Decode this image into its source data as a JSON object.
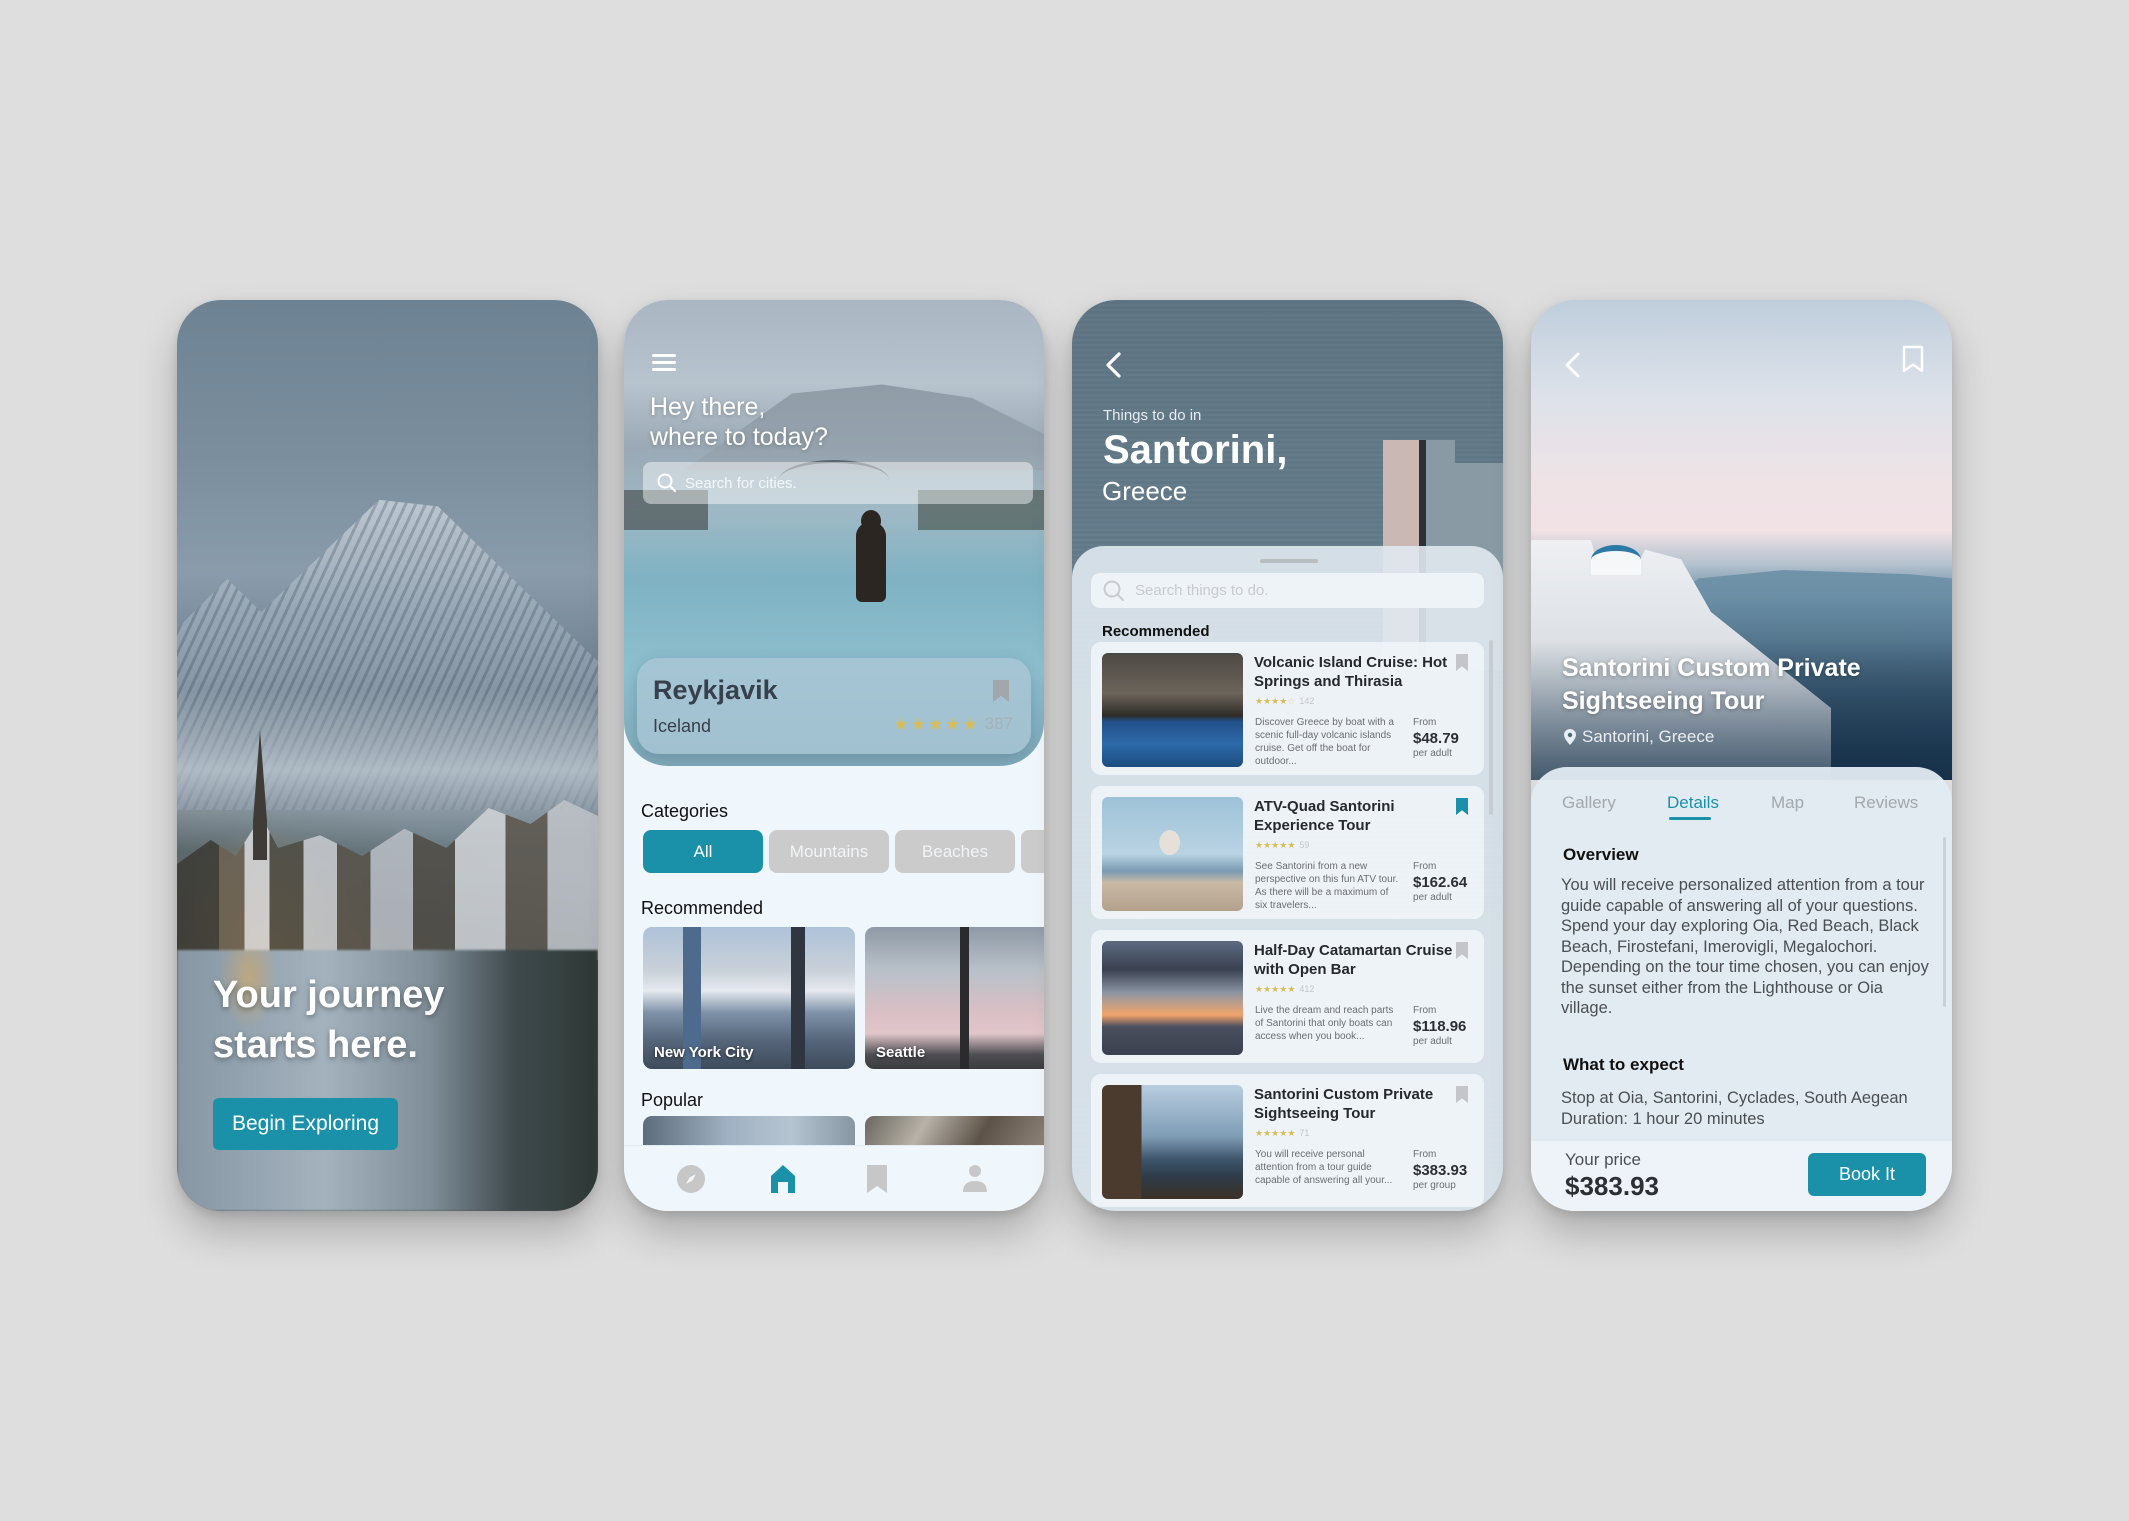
{
  "colors": {
    "accent": "#1a91a9",
    "background": "#dedede",
    "star": "#d6bd57"
  },
  "welcome": {
    "title_line1": "Your journey",
    "title_line2": "starts here.",
    "cta_label": "Begin Exploring"
  },
  "home": {
    "menu_icon": "hamburger-menu-icon",
    "greeting_line1": "Hey there,",
    "greeting_line2": "where to today?",
    "search_placeholder": "Search for cities.",
    "featured": {
      "city": "Reykjavik",
      "country": "Iceland",
      "rating": 5,
      "review_count": "387",
      "bookmarked": false
    },
    "categories_heading": "Categories",
    "categories": [
      {
        "label": "All",
        "active": true
      },
      {
        "label": "Mountains",
        "active": false
      },
      {
        "label": "Beaches",
        "active": false
      },
      {
        "label": "",
        "active": false
      }
    ],
    "recommended_heading": "Recommended",
    "recommended": [
      {
        "label": "New York City"
      },
      {
        "label": "Seattle"
      }
    ],
    "popular_heading": "Popular",
    "nav": [
      {
        "icon": "compass-icon",
        "label": "Explore",
        "active": false
      },
      {
        "icon": "home-icon",
        "label": "Home",
        "active": true
      },
      {
        "icon": "bookmark-icon",
        "label": "Saved",
        "active": false
      },
      {
        "icon": "profile-icon",
        "label": "Profile",
        "active": false
      }
    ]
  },
  "things_to_do": {
    "subtitle": "Things to do in",
    "city": "Santorini,",
    "country": "Greece",
    "search_placeholder": "Search things to do.",
    "recommended_heading": "Recommended",
    "activities": [
      {
        "title": "Volcanic Island Cruise: Hot Springs and Thirasia",
        "rating": 4,
        "review_count": "142",
        "description": "Discover Greece by boat with a scenic full-day volcanic islands cruise. Get off the boat for outdoor...",
        "from_label": "From",
        "price": "$48.79",
        "unit": "per adult",
        "bookmarked": false
      },
      {
        "title": "ATV-Quad Santorini Experience Tour",
        "rating": 5,
        "review_count": "59",
        "description": "See Santorini from a new perspective on this fun ATV tour. As there will be a maximum of six travelers...",
        "from_label": "From",
        "price": "$162.64",
        "unit": "per adult",
        "bookmarked": true
      },
      {
        "title": "Half-Day Catamartan Cruise with Open Bar",
        "rating": 5,
        "review_count": "412",
        "description": "Live the dream and reach parts of Santorini that only boats can access when you book...",
        "from_label": "From",
        "price": "$118.96",
        "unit": "per adult",
        "bookmarked": false
      },
      {
        "title": "Santorini Custom Private Sightseeing Tour",
        "rating": 5,
        "review_count": "71",
        "description": "You will receive personal attention from a tour guide capable of answering all your...",
        "from_label": "From",
        "price": "$383.93",
        "unit": "per group",
        "bookmarked": false
      }
    ]
  },
  "details": {
    "title": "Santorini Custom Private Sightseeing Tour",
    "location": "Santorini, Greece",
    "tabs": [
      {
        "label": "Gallery",
        "active": false
      },
      {
        "label": "Details",
        "active": true
      },
      {
        "label": "Map",
        "active": false
      },
      {
        "label": "Reviews",
        "active": false
      }
    ],
    "overview_heading": "Overview",
    "overview_text": "You will receive personalized attention from a tour guide capable of answering all of your questions. Spend your day exploring Oia, Red Beach, Black Beach, Firostefani, Imerovigli, Megalochori. Depending on the tour time chosen, you can enjoy the sunset either from the Lighthouse or Oia village.",
    "expect_heading": "What to expect",
    "expect_line1": "Stop at Oia, Santorini, Cyclades, South Aegean",
    "expect_line2": "Duration: 1 hour 20 minutes",
    "price_label": "Your price",
    "price": "$383.93",
    "book_label": "Book It"
  }
}
